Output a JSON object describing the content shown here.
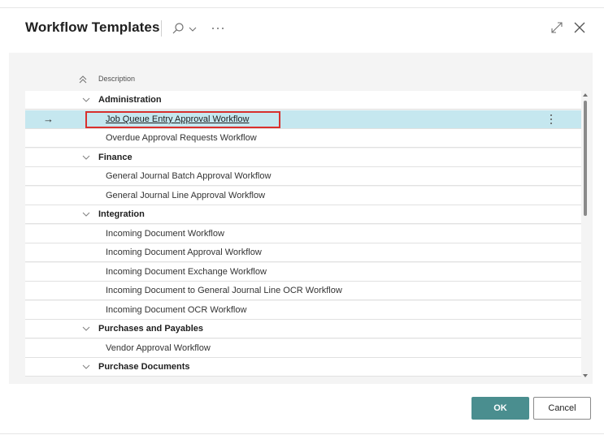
{
  "header": {
    "title": "Workflow Templates",
    "icons": [
      "search-icon",
      "chevron-down-icon",
      "more-icon",
      "expand-icon",
      "close-icon"
    ]
  },
  "table": {
    "column_header": "Description",
    "rows": [
      {
        "type": "group",
        "label": "Administration"
      },
      {
        "type": "item",
        "label": "Job Queue Entry Approval Workflow",
        "selected": true
      },
      {
        "type": "item",
        "label": "Overdue Approval Requests Workflow"
      },
      {
        "type": "group",
        "label": "Finance"
      },
      {
        "type": "item",
        "label": "General Journal Batch Approval Workflow"
      },
      {
        "type": "item",
        "label": "General Journal Line Approval Workflow"
      },
      {
        "type": "group",
        "label": "Integration"
      },
      {
        "type": "item",
        "label": "Incoming Document Workflow"
      },
      {
        "type": "item",
        "label": "Incoming Document Approval Workflow"
      },
      {
        "type": "item",
        "label": "Incoming Document Exchange Workflow"
      },
      {
        "type": "item",
        "label": "Incoming Document to General Journal Line OCR Workflow"
      },
      {
        "type": "item",
        "label": "Incoming Document OCR Workflow"
      },
      {
        "type": "group",
        "label": "Purchases and Payables"
      },
      {
        "type": "item",
        "label": "Vendor Approval Workflow"
      },
      {
        "type": "group",
        "label": "Purchase Documents"
      }
    ]
  },
  "footer": {
    "ok_label": "OK",
    "cancel_label": "Cancel"
  },
  "colors": {
    "accent": "#4a8e8f",
    "selected_row": "#c5e7ef",
    "highlight_border": "#d9302d"
  }
}
